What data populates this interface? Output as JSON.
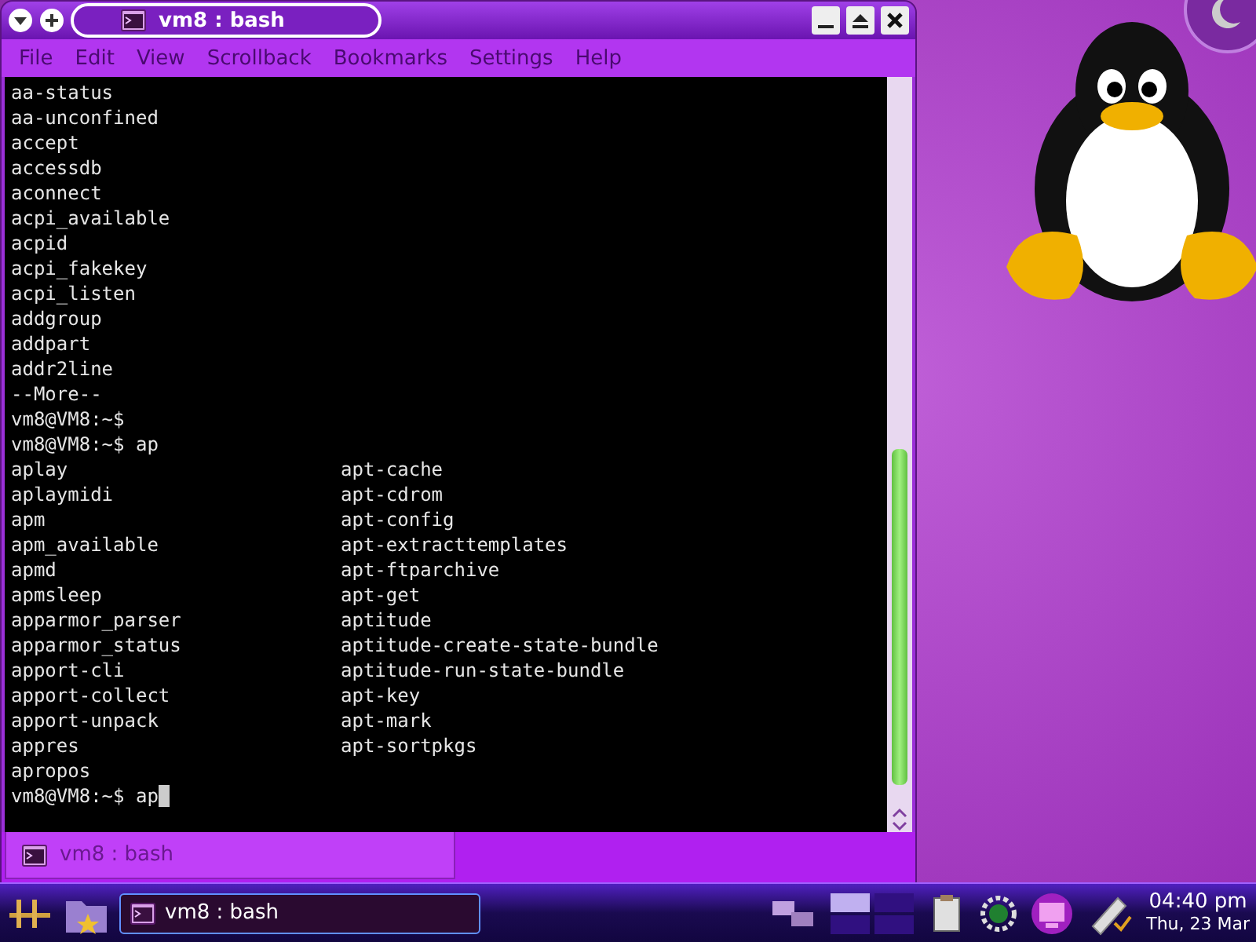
{
  "window": {
    "title": "vm8 : bash"
  },
  "menu": [
    "File",
    "Edit",
    "View",
    "Scrollback",
    "Bookmarks",
    "Settings",
    "Help"
  ],
  "terminal": {
    "lines": [
      {
        "cells": [
          "aa-status"
        ]
      },
      {
        "cells": [
          "aa-unconfined"
        ]
      },
      {
        "cells": [
          "accept"
        ]
      },
      {
        "cells": [
          "accessdb"
        ]
      },
      {
        "cells": [
          "aconnect"
        ]
      },
      {
        "cells": [
          "acpi_available"
        ]
      },
      {
        "cells": [
          "acpid"
        ]
      },
      {
        "cells": [
          "acpi_fakekey"
        ]
      },
      {
        "cells": [
          "acpi_listen"
        ]
      },
      {
        "cells": [
          "addgroup"
        ]
      },
      {
        "cells": [
          "addpart"
        ]
      },
      {
        "cells": [
          "addr2line"
        ]
      },
      {
        "cells": [
          "--More--"
        ]
      },
      {
        "cells": [
          "vm8@VM8:~$"
        ]
      },
      {
        "cells": [
          "vm8@VM8:~$ ap"
        ]
      },
      {
        "cells": [
          "aplay",
          "apt-cache"
        ]
      },
      {
        "cells": [
          "aplaymidi",
          "apt-cdrom"
        ]
      },
      {
        "cells": [
          "apm",
          "apt-config"
        ]
      },
      {
        "cells": [
          "apm_available",
          "apt-extracttemplates"
        ]
      },
      {
        "cells": [
          "apmd",
          "apt-ftparchive"
        ]
      },
      {
        "cells": [
          "apmsleep",
          "apt-get"
        ]
      },
      {
        "cells": [
          "apparmor_parser",
          "aptitude"
        ]
      },
      {
        "cells": [
          "apparmor_status",
          "aptitude-create-state-bundle"
        ]
      },
      {
        "cells": [
          "apport-cli",
          "aptitude-run-state-bundle"
        ]
      },
      {
        "cells": [
          "apport-collect",
          "apt-key"
        ]
      },
      {
        "cells": [
          "apport-unpack",
          "apt-mark"
        ]
      },
      {
        "cells": [
          "appres",
          "apt-sortpkgs"
        ]
      },
      {
        "cells": [
          "apropos"
        ]
      }
    ],
    "input_line": "vm8@VM8:~$ ap"
  },
  "session_tab": {
    "label": "vm8 : bash"
  },
  "taskbar": {
    "tasks": [
      {
        "label": "vm8 : bash",
        "selected": true
      }
    ],
    "clock": {
      "time": "04:40 pm",
      "date": "Thu, 23 Mar"
    }
  }
}
